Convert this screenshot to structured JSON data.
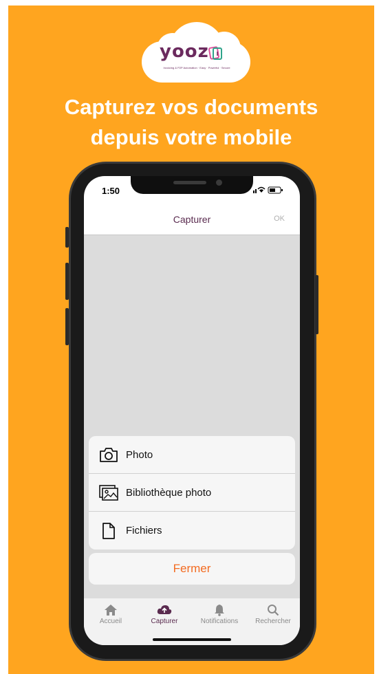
{
  "logo": {
    "text": "yooz",
    "tagline": "Invoicing & P2P Automation · Easy · Powerful · Secure"
  },
  "headline": {
    "line1": "Capturez vos documents",
    "line2": "depuis votre mobile"
  },
  "status": {
    "time": "1:50",
    "icons": "wifi-icon battery-icon"
  },
  "navbar": {
    "title": "Capturer",
    "ok_label": "OK"
  },
  "sheet": {
    "items": [
      {
        "label": "Photo",
        "icon": "camera-icon"
      },
      {
        "label": "Bibliothèque photo",
        "icon": "photo-library-icon"
      },
      {
        "label": "Fichiers",
        "icon": "file-icon"
      }
    ],
    "close_label": "Fermer"
  },
  "tabbar": {
    "items": [
      {
        "label": "Accueil",
        "icon": "home-icon"
      },
      {
        "label": "Capturer",
        "icon": "cloud-upload-icon",
        "active": true
      },
      {
        "label": "Notifications",
        "icon": "bell-icon"
      },
      {
        "label": "Rechercher",
        "icon": "search-icon"
      }
    ]
  },
  "colors": {
    "background": "#FFA51F",
    "accent": "#F36B21",
    "brand": "#5a2b4f"
  }
}
